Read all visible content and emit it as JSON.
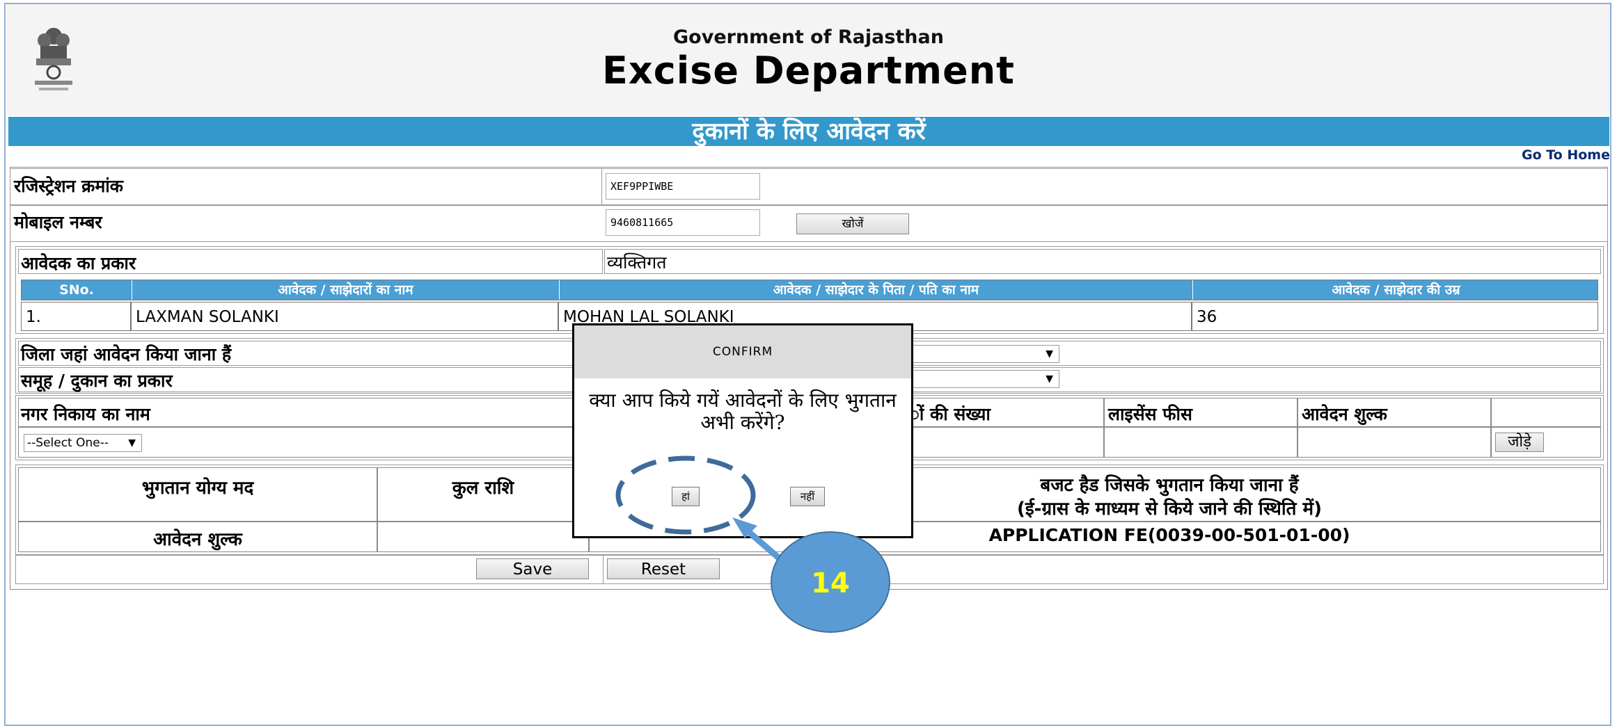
{
  "header": {
    "gov_title": "Government of Rajasthan",
    "dept_title": "Excise Department"
  },
  "banner": {
    "title": "दुकानों के लिए आवेदन करें"
  },
  "nav": {
    "go_home": "Go To Home"
  },
  "form": {
    "registration_label": "रजिस्ट्रेशन क्रमांक",
    "registration_value": "XEF9PPIWBE",
    "mobile_label": "मोबाइल नम्बर",
    "mobile_value": "9460811665",
    "search_button": "खोजें",
    "applicant_type_label": "आवेदक का प्रकार",
    "applicant_type_value": "व्यक्तिगत"
  },
  "applicants_table": {
    "headers": [
      "SNo.",
      "आवेदक / साझेदारों का नाम",
      "आवेदक / साझेदार के पिता / पति का नाम",
      "आवेदक / साझेदार की उम्र"
    ],
    "rows": [
      {
        "sno": "1.",
        "name": "LAXMAN SOLANKI",
        "father": "MOHAN LAL SOLANKI",
        "age": "36"
      }
    ]
  },
  "location": {
    "district_label": "जिला जहां आवेदन किया जाना हैं",
    "group_label": "समूह / दुकान का प्रकार",
    "municipal_label": "नगर निकाय का नाम",
    "count_label": "ों की संख्या",
    "license_fee_label": "लाइसेंस फीस",
    "application_fee_label": "आवेदन शुल्क",
    "select_value": "--Select One--",
    "add_button": "जोड़े"
  },
  "payment": {
    "col_item": "भुगतान योग्य मद",
    "col_total": "कुल राशि",
    "col_budget_line1": "बजट हैड जिसके भुगतान किया जाना हैं",
    "col_budget_line2": "(ई-ग्रास के माध्यम से किये जाने की स्थिति में)",
    "row_item": "आवेदन शुल्क",
    "row_budget": "APPLICATION FE(0039-00-501-01-00)"
  },
  "actions": {
    "save": "Save",
    "reset": "Reset"
  },
  "dialog": {
    "title": "CONFIRM",
    "message": "क्या आप किये गयें आवेदनों के लिए भुगतान अभी करेंगे?",
    "yes": "हां",
    "no": "नहीं"
  },
  "annotation": {
    "step": "14",
    "color": "#5b9bd5",
    "text_color": "#ffff00"
  }
}
